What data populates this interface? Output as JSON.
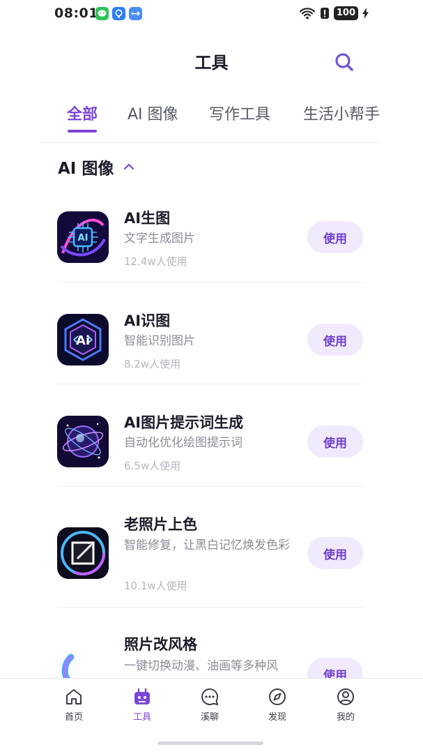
{
  "status_bar": {
    "time": "08:01",
    "battery": "100"
  },
  "header": {
    "title": "工具",
    "search_icon": "search-icon"
  },
  "tabs": [
    {
      "label": "全部",
      "active": true
    },
    {
      "label": "AI 图像",
      "active": false
    },
    {
      "label": "写作工具",
      "active": false
    },
    {
      "label": "生活小帮手",
      "active": false
    }
  ],
  "section": {
    "title": "AI 图像",
    "toggle_icon": "chevron-up-icon"
  },
  "tools": [
    {
      "name": "AI生图",
      "desc": "文字生成图片",
      "usage": "12.4w人使用",
      "button": "使用",
      "icon": "ai-chip-icon"
    },
    {
      "name": "AI识图",
      "desc": "智能识别图片",
      "usage": "8.2w人使用",
      "button": "使用",
      "icon": "ai-hexagon-icon"
    },
    {
      "name": "AI图片提示词生成",
      "desc": "自动化优化绘图提示词",
      "usage": "6.5w人使用",
      "button": "使用",
      "icon": "crystal-ball-icon"
    },
    {
      "name": "老照片上色",
      "desc": "智能修复，让黑白记忆焕发色彩",
      "usage": "10.1w人使用",
      "button": "使用",
      "icon": "photo-wand-icon"
    },
    {
      "name": "照片改风格",
      "desc": "一键切换动漫、油画等多种风",
      "usage": "",
      "button": "使用",
      "icon": "style-swirl-icon"
    }
  ],
  "bottom_nav": [
    {
      "label": "首页",
      "icon": "home-icon",
      "active": false
    },
    {
      "label": "工具",
      "icon": "robot-icon",
      "active": true
    },
    {
      "label": "溪聊",
      "icon": "chat-icon",
      "active": false
    },
    {
      "label": "发现",
      "icon": "compass-icon",
      "active": false
    },
    {
      "label": "我的",
      "icon": "user-icon",
      "active": false
    }
  ],
  "colors": {
    "accent": "#7b45d8",
    "button_bg": "#f1eafd",
    "text_primary": "#1a1a2a",
    "text_secondary": "#8a8d99"
  }
}
